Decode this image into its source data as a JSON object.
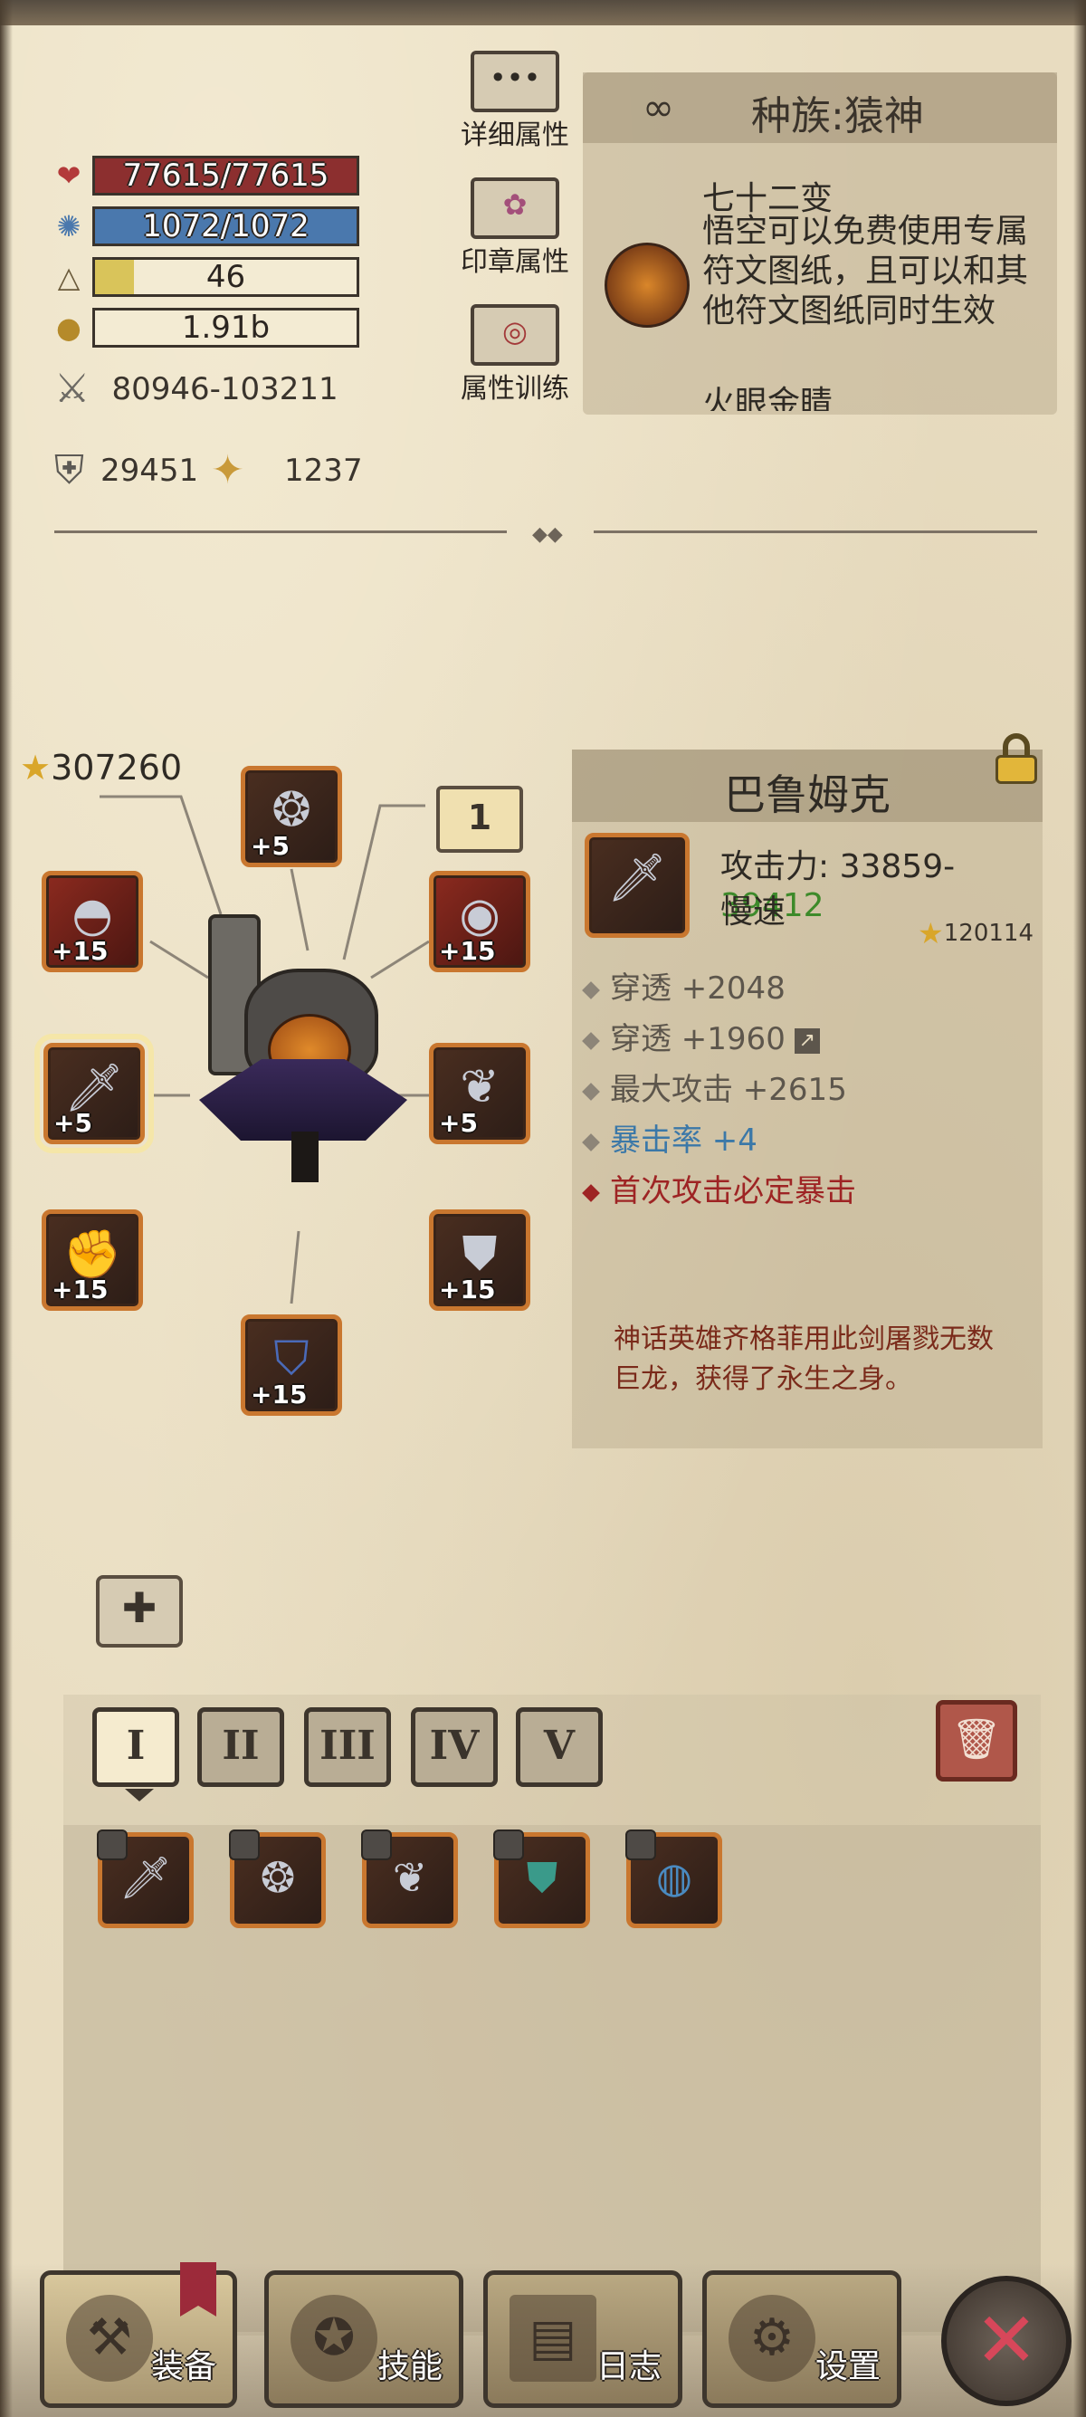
{
  "stats": {
    "hp": "77615/77615",
    "hp_ratio": 1.0,
    "mp": "1072/1072",
    "mp_ratio": 1.0,
    "level": "46",
    "level_ratio": 0.15,
    "gold": "1.91b",
    "attack_range": "80946-103211",
    "armor": "29451",
    "luck": "1237"
  },
  "side_buttons": {
    "detail_attr": "详细属性",
    "seal_attr": "印章属性",
    "attr_train": "属性训练"
  },
  "race": {
    "title": "种族:猿神",
    "skill_name": "七十二变",
    "skill_desc": "悟空可以免费使用专属符文图纸，且可以和其他符文图纸同时生效",
    "more_text": "火眼金睛"
  },
  "equipment": {
    "power_score": "307260",
    "page_number": "1",
    "slots": [
      {
        "icon": "necklace-icon",
        "level": "+5"
      },
      {
        "icon": "shoulder-armor-icon",
        "level": "+15"
      },
      {
        "icon": "ring-icon",
        "level": "+15"
      },
      {
        "icon": "sword-icon",
        "level": "+5"
      },
      {
        "icon": "wings-icon",
        "level": "+5"
      },
      {
        "icon": "gauntlet-icon",
        "level": "+15"
      },
      {
        "icon": "chest-armor-icon",
        "level": "+15"
      },
      {
        "icon": "boots-icon",
        "level": "+15"
      }
    ]
  },
  "item": {
    "name": "巴鲁姆克",
    "attack_label": "攻击力: ",
    "attack_low": "33859",
    "attack_sep": "-",
    "attack_high": "39412",
    "speed": "慢速",
    "score": "120114",
    "attrs": [
      {
        "text": "穿透 +2048"
      },
      {
        "text": "穿透 +1960"
      },
      {
        "text": "最大攻击 +2615"
      },
      {
        "text": "暴击率 +4"
      },
      {
        "text": "首次攻击必定暴击"
      }
    ],
    "lore": "神话英雄齐格菲用此剑屠戮无数巨龙，获得了永生之身。"
  },
  "tabs": [
    "I",
    "II",
    "III",
    "IV",
    "V"
  ],
  "inventory": [
    {
      "icon": "sword-icon"
    },
    {
      "icon": "necklace-icon"
    },
    {
      "icon": "wings-icon"
    },
    {
      "icon": "gem-armor-icon"
    },
    {
      "icon": "bracelet-icon"
    }
  ],
  "nav": {
    "equip": "装备",
    "skills": "技能",
    "log": "日志",
    "settings": "设置"
  },
  "colors": {
    "hp": "#8c2f2f",
    "mp": "#4a78ad",
    "xp": "#d9c45a",
    "attack_high": "#3d8a2a",
    "crit_blue": "#3b78a8",
    "crit_red": "#9e2424"
  }
}
